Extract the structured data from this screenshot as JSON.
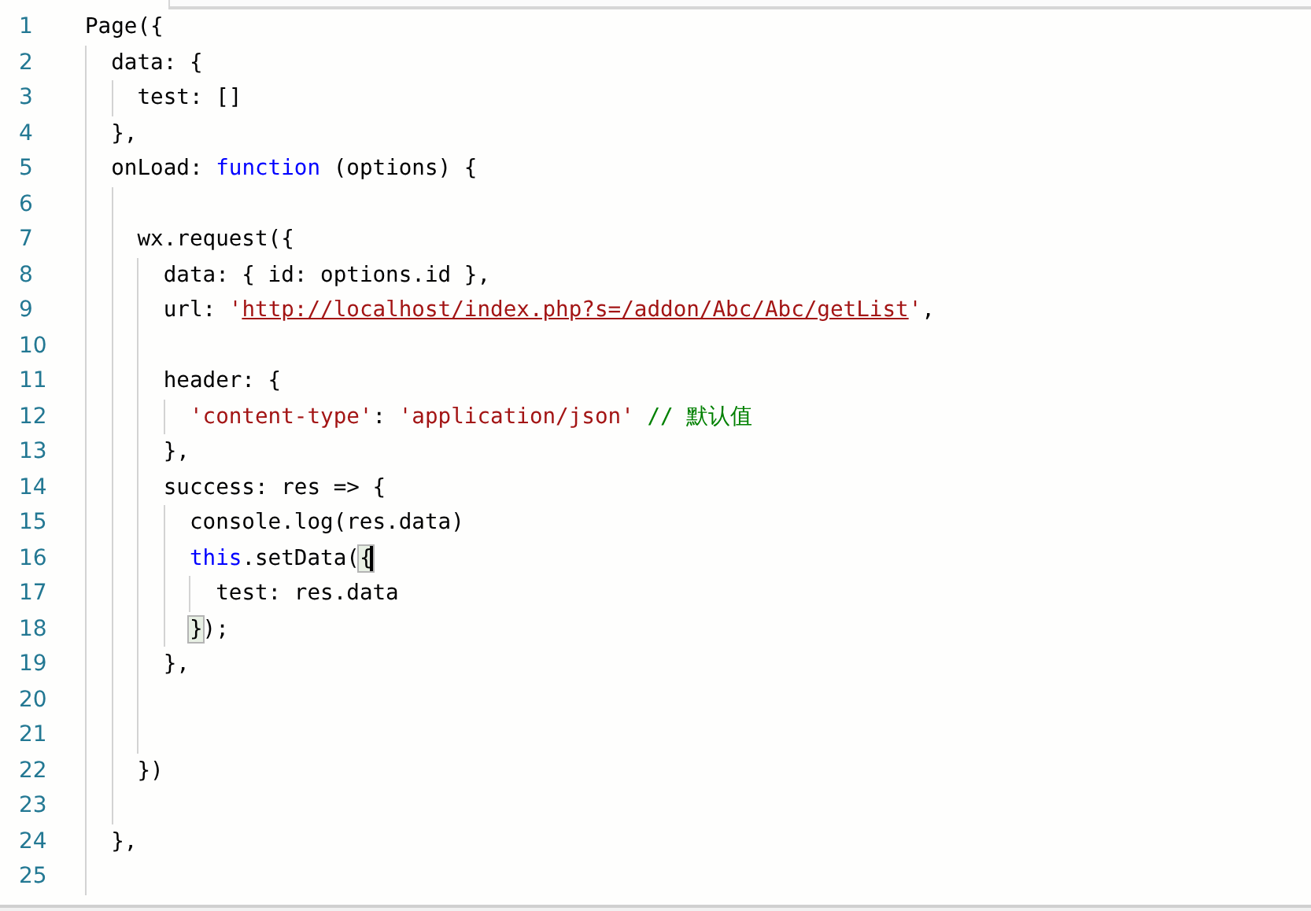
{
  "editor": {
    "lines": [
      {
        "number": "1",
        "tokens": [
          {
            "kind": "plain",
            "text": "Page({"
          }
        ]
      },
      {
        "number": "2",
        "tokens": [
          {
            "kind": "plain",
            "text": "  data: {"
          }
        ]
      },
      {
        "number": "3",
        "tokens": [
          {
            "kind": "plain",
            "text": "    test: []"
          }
        ]
      },
      {
        "number": "4",
        "tokens": [
          {
            "kind": "plain",
            "text": "  },"
          }
        ]
      },
      {
        "number": "5",
        "tokens": [
          {
            "kind": "plain",
            "text": "  onLoad: "
          },
          {
            "kind": "keyword",
            "text": "function"
          },
          {
            "kind": "plain",
            "text": " (options) {"
          }
        ]
      },
      {
        "number": "6"
      },
      {
        "number": "7",
        "tokens": [
          {
            "kind": "plain",
            "text": "    wx.request({"
          }
        ]
      },
      {
        "number": "8",
        "tokens": [
          {
            "kind": "plain",
            "text": "      data: { id: options.id },"
          }
        ]
      },
      {
        "number": "9",
        "tokens": [
          {
            "kind": "plain",
            "text": "      url: "
          },
          {
            "kind": "string",
            "text": "'"
          },
          {
            "kind": "link",
            "text": "http://localhost/index.php?s=/addon/Abc/Abc/getList"
          },
          {
            "kind": "string",
            "text": "'"
          },
          {
            "kind": "plain",
            "text": ","
          }
        ]
      },
      {
        "number": "10"
      },
      {
        "number": "11",
        "tokens": [
          {
            "kind": "plain",
            "text": "      header: {"
          }
        ]
      },
      {
        "number": "12",
        "tokens": [
          {
            "kind": "string",
            "text": "        'content-type'"
          },
          {
            "kind": "plain",
            "text": ": "
          },
          {
            "kind": "string",
            "text": "'application/json'"
          },
          {
            "kind": "comment",
            "text": " // 默认值"
          }
        ]
      },
      {
        "number": "13",
        "tokens": [
          {
            "kind": "plain",
            "text": "      },"
          }
        ]
      },
      {
        "number": "14",
        "tokens": [
          {
            "kind": "plain",
            "text": "      success: res => {"
          }
        ]
      },
      {
        "number": "15",
        "tokens": [
          {
            "kind": "plain",
            "text": "        console.log(res.data)"
          }
        ]
      },
      {
        "number": "16",
        "tokens": [
          {
            "kind": "keyword",
            "text": "        this"
          },
          {
            "kind": "plain",
            "text": ".setData("
          },
          {
            "kind": "bracket_match",
            "text": "{",
            "cursor": true
          }
        ]
      },
      {
        "number": "17",
        "tokens": [
          {
            "kind": "plain",
            "text": "          test: res.data"
          }
        ]
      },
      {
        "number": "18",
        "tokens": [
          {
            "kind": "bracket_match",
            "text": "        }"
          },
          {
            "kind": "plain",
            "text": ");"
          }
        ]
      },
      {
        "number": "19",
        "tokens": [
          {
            "kind": "plain",
            "text": "      },"
          }
        ]
      },
      {
        "number": "20"
      },
      {
        "number": "21"
      },
      {
        "number": "22",
        "tokens": [
          {
            "kind": "plain",
            "text": "    })"
          }
        ]
      },
      {
        "number": "23"
      },
      {
        "number": "24",
        "tokens": [
          {
            "kind": "plain",
            "text": "  },"
          }
        ]
      },
      {
        "number": "25"
      }
    ]
  }
}
